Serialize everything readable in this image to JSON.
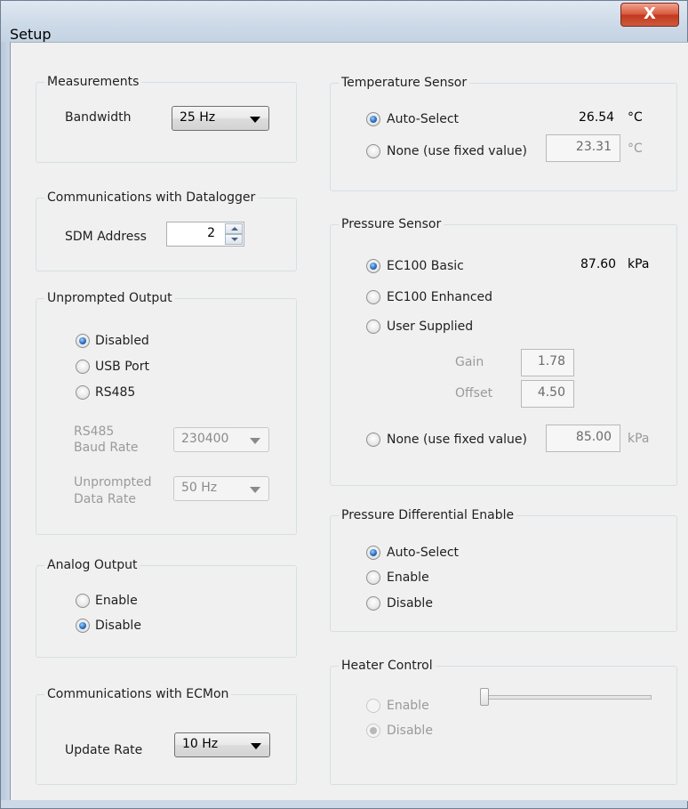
{
  "window": {
    "title": "Setup",
    "close_glyph": "X"
  },
  "measurements": {
    "legend": "Measurements",
    "bandwidth_label": "Bandwidth",
    "bandwidth_value": "25 Hz"
  },
  "comm_datalogger": {
    "legend": "Communications with Datalogger",
    "sdm_label": "SDM Address",
    "sdm_value": "2"
  },
  "unprompted": {
    "legend": "Unprompted Output",
    "options": [
      "Disabled",
      "USB Port",
      "RS485"
    ],
    "selected": "Disabled",
    "baud_label_1": "RS485",
    "baud_label_2": "Baud Rate",
    "baud_value": "230400",
    "rate_label_1": "Unprompted",
    "rate_label_2": "Data Rate",
    "rate_value": "50 Hz"
  },
  "analog": {
    "legend": "Analog Output",
    "options": [
      "Enable",
      "Disable"
    ],
    "selected": "Disable"
  },
  "comm_ecmon": {
    "legend": "Communications with ECMon",
    "update_label": "Update Rate",
    "update_value": "10 Hz"
  },
  "temperature": {
    "legend": "Temperature Sensor",
    "auto_label": "Auto-Select",
    "auto_value": "26.54",
    "auto_unit": "°C",
    "none_label": "None (use fixed value)",
    "fixed_value": "23.31",
    "fixed_unit": "°C",
    "selected": "Auto-Select"
  },
  "pressure": {
    "legend": "Pressure Sensor",
    "basic_label": "EC100 Basic",
    "basic_value": "87.60",
    "basic_unit": "kPa",
    "enhanced_label": "EC100 Enhanced",
    "user_label": "User Supplied",
    "gain_label": "Gain",
    "gain_value": "1.78",
    "offset_label": "Offset",
    "offset_value": "4.50",
    "none_label": "None (use fixed value)",
    "fixed_value": "85.00",
    "fixed_unit": "kPa",
    "selected": "EC100 Basic"
  },
  "pressure_diff": {
    "legend": "Pressure Differential Enable",
    "options": [
      "Auto-Select",
      "Enable",
      "Disable"
    ],
    "selected": "Auto-Select"
  },
  "heater": {
    "legend": "Heater Control",
    "options": [
      "Enable",
      "Disable"
    ],
    "selected": "Disable",
    "slider_value": 0
  },
  "icons": {
    "close": "close-icon",
    "dropdown": "chevron-down-icon",
    "spin": "spin-arrows-icon"
  }
}
